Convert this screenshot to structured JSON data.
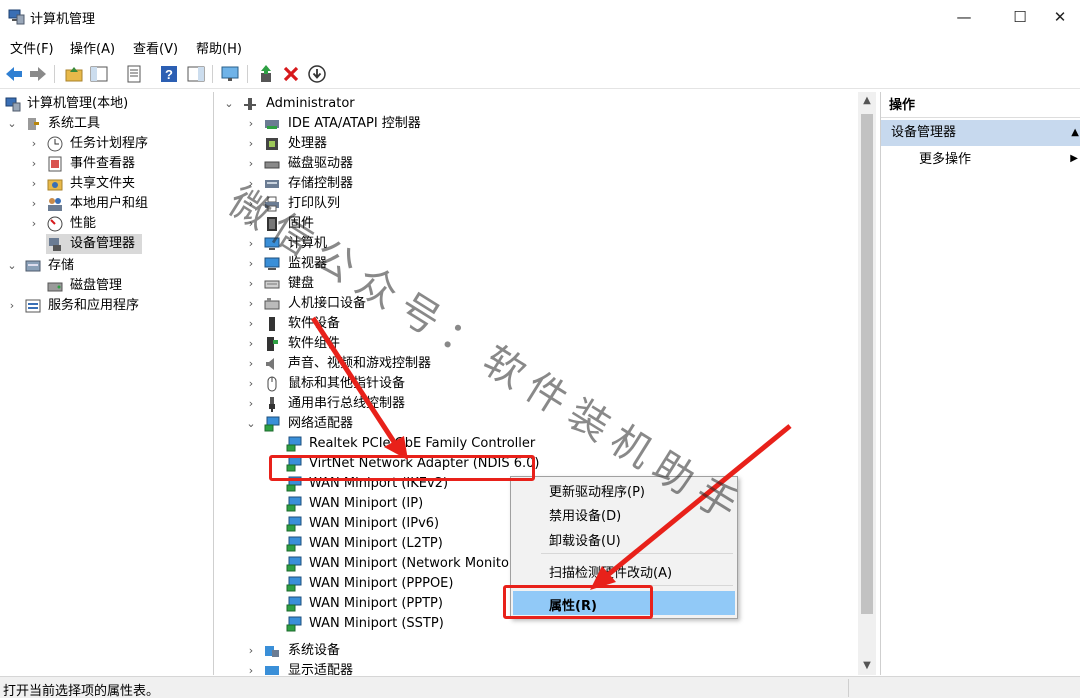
{
  "window": {
    "title": "计算机管理",
    "min_glyph": "—",
    "max_glyph": "☐",
    "close_glyph": "✕"
  },
  "menu": [
    "文件(F)",
    "操作(A)",
    "查看(V)",
    "帮助(H)"
  ],
  "left_tree": [
    {
      "label": "计算机管理(本地)",
      "icon": "computer-management-icon"
    },
    {
      "label": "系统工具",
      "icon": "tools-icon"
    },
    {
      "label": "任务计划程序",
      "icon": "clock-icon"
    },
    {
      "label": "事件查看器",
      "icon": "event-viewer-icon"
    },
    {
      "label": "共享文件夹",
      "icon": "shared-folder-icon"
    },
    {
      "label": "本地用户和组",
      "icon": "users-icon"
    },
    {
      "label": "性能",
      "icon": "performance-icon"
    },
    {
      "label": "设备管理器",
      "icon": "device-manager-icon"
    },
    {
      "label": "存储",
      "icon": "storage-icon"
    },
    {
      "label": "磁盘管理",
      "icon": "disk-icon"
    },
    {
      "label": "服务和应用程序",
      "icon": "services-icon"
    }
  ],
  "device_tree": {
    "root": "Administrator",
    "categories": [
      "IDE ATA/ATAPI 控制器",
      "处理器",
      "磁盘驱动器",
      "存储控制器",
      "打印队列",
      "固件",
      "计算机",
      "监视器",
      "键盘",
      "人机接口设备",
      "软件设备",
      "软件组件",
      "声音、视频和游戏控制器",
      "鼠标和其他指针设备",
      "通用串行总线控制器",
      "网络适配器"
    ],
    "network_adapters": [
      "Realtek PCIe GbE Family Controller",
      "VirtNet Network Adapter (NDIS 6.0)",
      "WAN Miniport (IKEv2)",
      "WAN Miniport (IP)",
      "WAN Miniport (IPv6)",
      "WAN Miniport (L2TP)",
      "WAN Miniport (Network Monitor)",
      "WAN Miniport (PPPOE)",
      "WAN Miniport (PPTP)",
      "WAN Miniport (SSTP)"
    ],
    "after": [
      "系统设备",
      "显示适配器"
    ]
  },
  "context_menu": {
    "update_driver": "更新驱动程序(P)",
    "disable": "禁用设备(D)",
    "uninstall": "卸载设备(U)",
    "scan": "扫描检测硬件改动(A)",
    "properties": "属性(R)"
  },
  "actions": {
    "header": "操作",
    "section": "设备管理器",
    "more": "更多操作"
  },
  "status": "打开当前选择项的属性表。",
  "watermark": "微信公众号：软件装机助手",
  "colors": {
    "highlight_red": "#e8211a",
    "menu_highlight": "#91c9f7",
    "actions_section_bg": "#c7d9ee"
  }
}
